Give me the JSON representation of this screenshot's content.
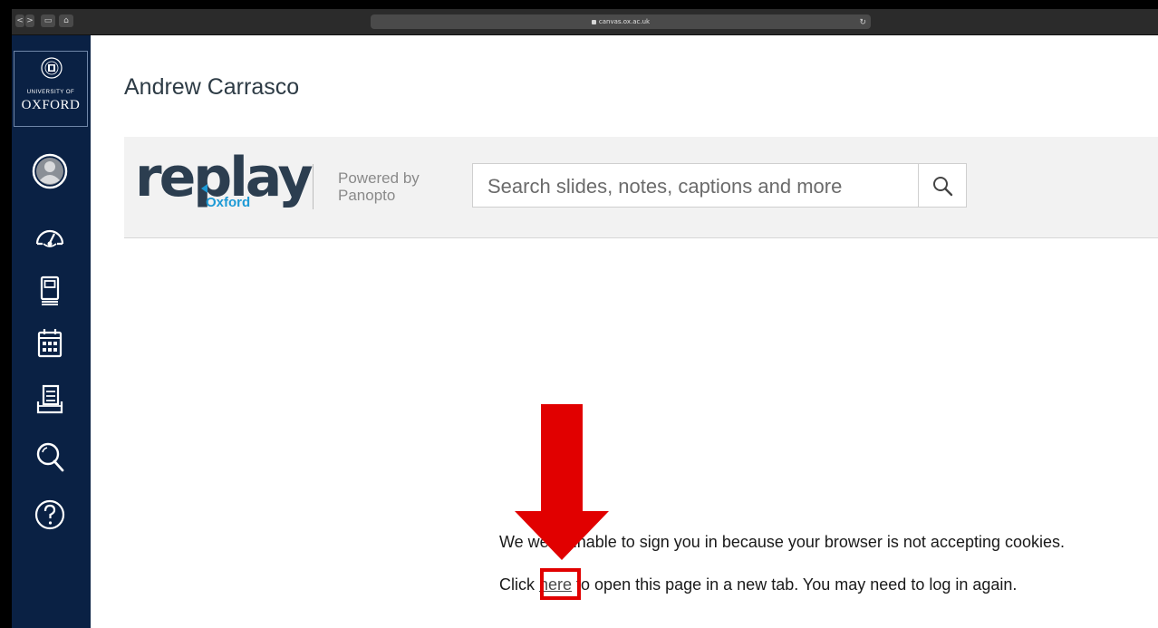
{
  "browser": {
    "url": "canvas.ox.ac.uk",
    "back_label": "<",
    "forward_label": ">",
    "sidebar_btn_label": "▭",
    "home_btn_label": "⌂",
    "reload_label": "↻"
  },
  "sidebar": {
    "logo_small": "UNIVERSITY OF",
    "logo_big": "OXFORD",
    "items": [
      {
        "icon": "account-icon"
      },
      {
        "icon": "dashboard-icon"
      },
      {
        "icon": "courses-icon"
      },
      {
        "icon": "calendar-icon"
      },
      {
        "icon": "inbox-icon"
      },
      {
        "icon": "search-icon"
      },
      {
        "icon": "help-icon"
      }
    ]
  },
  "page": {
    "title": "Andrew Carrasco"
  },
  "replay": {
    "brand": "replay",
    "brand_sub": "Oxford",
    "powered_line1": "Powered by",
    "powered_line2": "Panopto",
    "search_placeholder": "Search slides, notes, captions and more"
  },
  "message": {
    "line1": "We were unable to sign you in because your browser is not accepting cookies.",
    "line2_prefix": "Click ",
    "link_text": "here",
    "line2_suffix": " to open this page in a new tab. You may need to log in again."
  },
  "colors": {
    "sidebar_bg": "#0a2144",
    "brand_blue": "#1d9ad6",
    "annotation_red": "#e10000"
  }
}
